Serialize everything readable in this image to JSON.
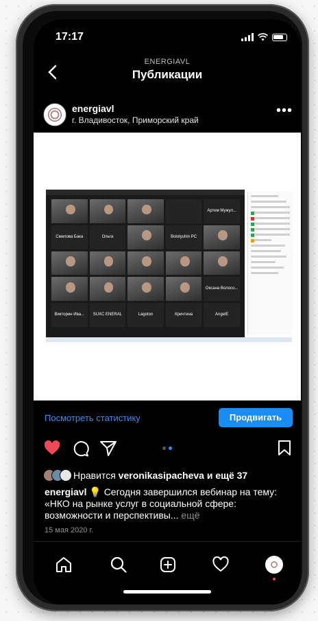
{
  "status_bar": {
    "time": "17:17"
  },
  "header": {
    "account": "ENERGIAVL",
    "title": "Публикации"
  },
  "post": {
    "username": "energiavl",
    "location": "г. Владивосток, Приморский край",
    "view_stats": "Посмотреть статистику",
    "promote": "Продвигать",
    "likes_prefix": "Нравится",
    "liked_by": "veronikasipacheva",
    "likes_suffix": "и ещё 37",
    "caption_user": "energiavl",
    "caption_text": "💡 Сегодня завершился вебинар на тему: «НКО на рынке услуг в социальной сфере: возможности и перспективы...",
    "caption_more": "ещё",
    "date": "15 мая 2020 г."
  },
  "zoom_tiles": [
    {
      "type": "video",
      "name": ""
    },
    {
      "type": "video",
      "name": ""
    },
    {
      "type": "video",
      "name": ""
    },
    {
      "type": "dark",
      "name": ""
    },
    {
      "type": "dark",
      "name": "Артем Мужул..."
    },
    {
      "type": "dark",
      "name": "Смелова Бака"
    },
    {
      "type": "dark",
      "name": "Ольга"
    },
    {
      "type": "video",
      "name": ""
    },
    {
      "type": "dark",
      "name": "Bolotyuhin PC"
    },
    {
      "type": "video",
      "name": ""
    },
    {
      "type": "video",
      "name": ""
    },
    {
      "type": "video",
      "name": ""
    },
    {
      "type": "video",
      "name": ""
    },
    {
      "type": "video",
      "name": ""
    },
    {
      "type": "video",
      "name": ""
    },
    {
      "type": "video",
      "name": ""
    },
    {
      "type": "video",
      "name": ""
    },
    {
      "type": "video",
      "name": ""
    },
    {
      "type": "video",
      "name": ""
    },
    {
      "type": "dark",
      "name": "Оксана Волосо..."
    },
    {
      "type": "dark",
      "name": "Викторин Ива..."
    },
    {
      "type": "dark",
      "name": "SUXC ENERAL"
    },
    {
      "type": "dark",
      "name": "Lagoton"
    },
    {
      "type": "dark",
      "name": "Кричтина"
    },
    {
      "type": "dark",
      "name": "AngelE"
    }
  ],
  "colors": {
    "accent": "#1a8cf5",
    "like": "#ed4956"
  }
}
